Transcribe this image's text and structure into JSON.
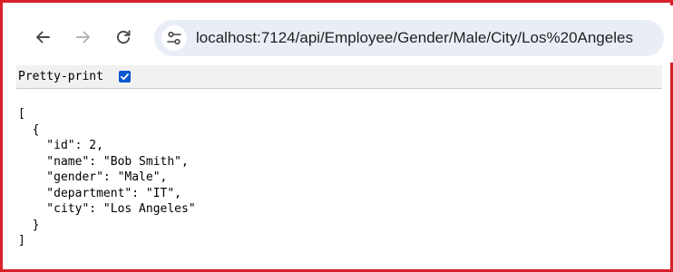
{
  "browser": {
    "url": "localhost:7124/api/Employee/Gender/Male/City/Los%20Angeles",
    "icons": {
      "back": "arrow-left-icon",
      "forward": "arrow-right-icon",
      "reload": "reload-icon",
      "site_info": "tune-icon"
    }
  },
  "viewer": {
    "pretty_print_label": "Pretty-print",
    "pretty_print_checked": true
  },
  "json_lines": [
    "[",
    "  {",
    "    \"id\": 2,",
    "    \"name\": \"Bob Smith\",",
    "    \"gender\": \"Male\",",
    "    \"department\": \"IT\",",
    "    \"city\": \"Los Angeles\"",
    "  }",
    "]"
  ],
  "colors": {
    "frame_border": "#d9202a",
    "omnibox_bg": "#e9eef6",
    "checkbox_accent": "#0b57d0"
  }
}
